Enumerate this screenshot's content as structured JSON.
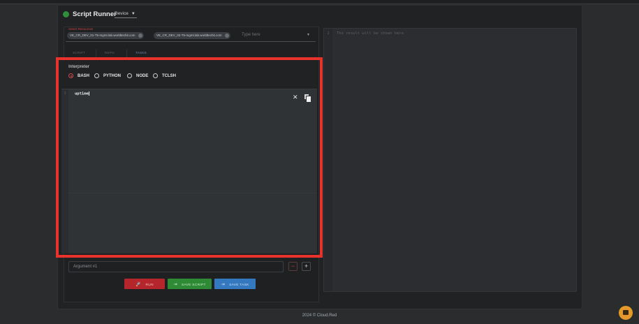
{
  "app": {
    "title": "Script Runner",
    "status_color": "#2f8f3a",
    "device_select": "Device"
  },
  "resources": {
    "label": "Select Resources",
    "chips": [
      "VE_CR_DEV_01-T5-mgmt.lab.worldtechit.com",
      "VE_CR_DEV_02-T5-mgmt.lab.worldtechit.com"
    ],
    "placeholder": "Type here"
  },
  "tabs": [
    {
      "label": "SCRIPT",
      "active": false
    },
    {
      "label": "REPO",
      "active": false
    },
    {
      "label": "TASKS",
      "active": true
    }
  ],
  "interpreter": {
    "label": "Interpreter",
    "options": [
      {
        "label": "BASH",
        "selected": true
      },
      {
        "label": "PYTHON",
        "selected": false
      },
      {
        "label": "NODE",
        "selected": false
      },
      {
        "label": "TCLSH",
        "selected": false
      }
    ]
  },
  "editor": {
    "line_number": "1",
    "code": "uptime",
    "clear_icon": "close-icon",
    "copy_icon": "copy-icon"
  },
  "argument": {
    "placeholder": "Argument #1",
    "minus_label": "−",
    "plus_label": "+"
  },
  "actions": {
    "run": "RUN",
    "save_script": "SAVE SCRIPT",
    "save_task": "SAVE TASK",
    "run_color": "#b4262b",
    "save_script_color": "#2f8a36",
    "save_task_color": "#3478bf"
  },
  "result": {
    "line_number": "1",
    "placeholder": "The result will be shown here"
  },
  "footer": "2024 © Cloud.Red",
  "highlight_color": "#e8322b"
}
